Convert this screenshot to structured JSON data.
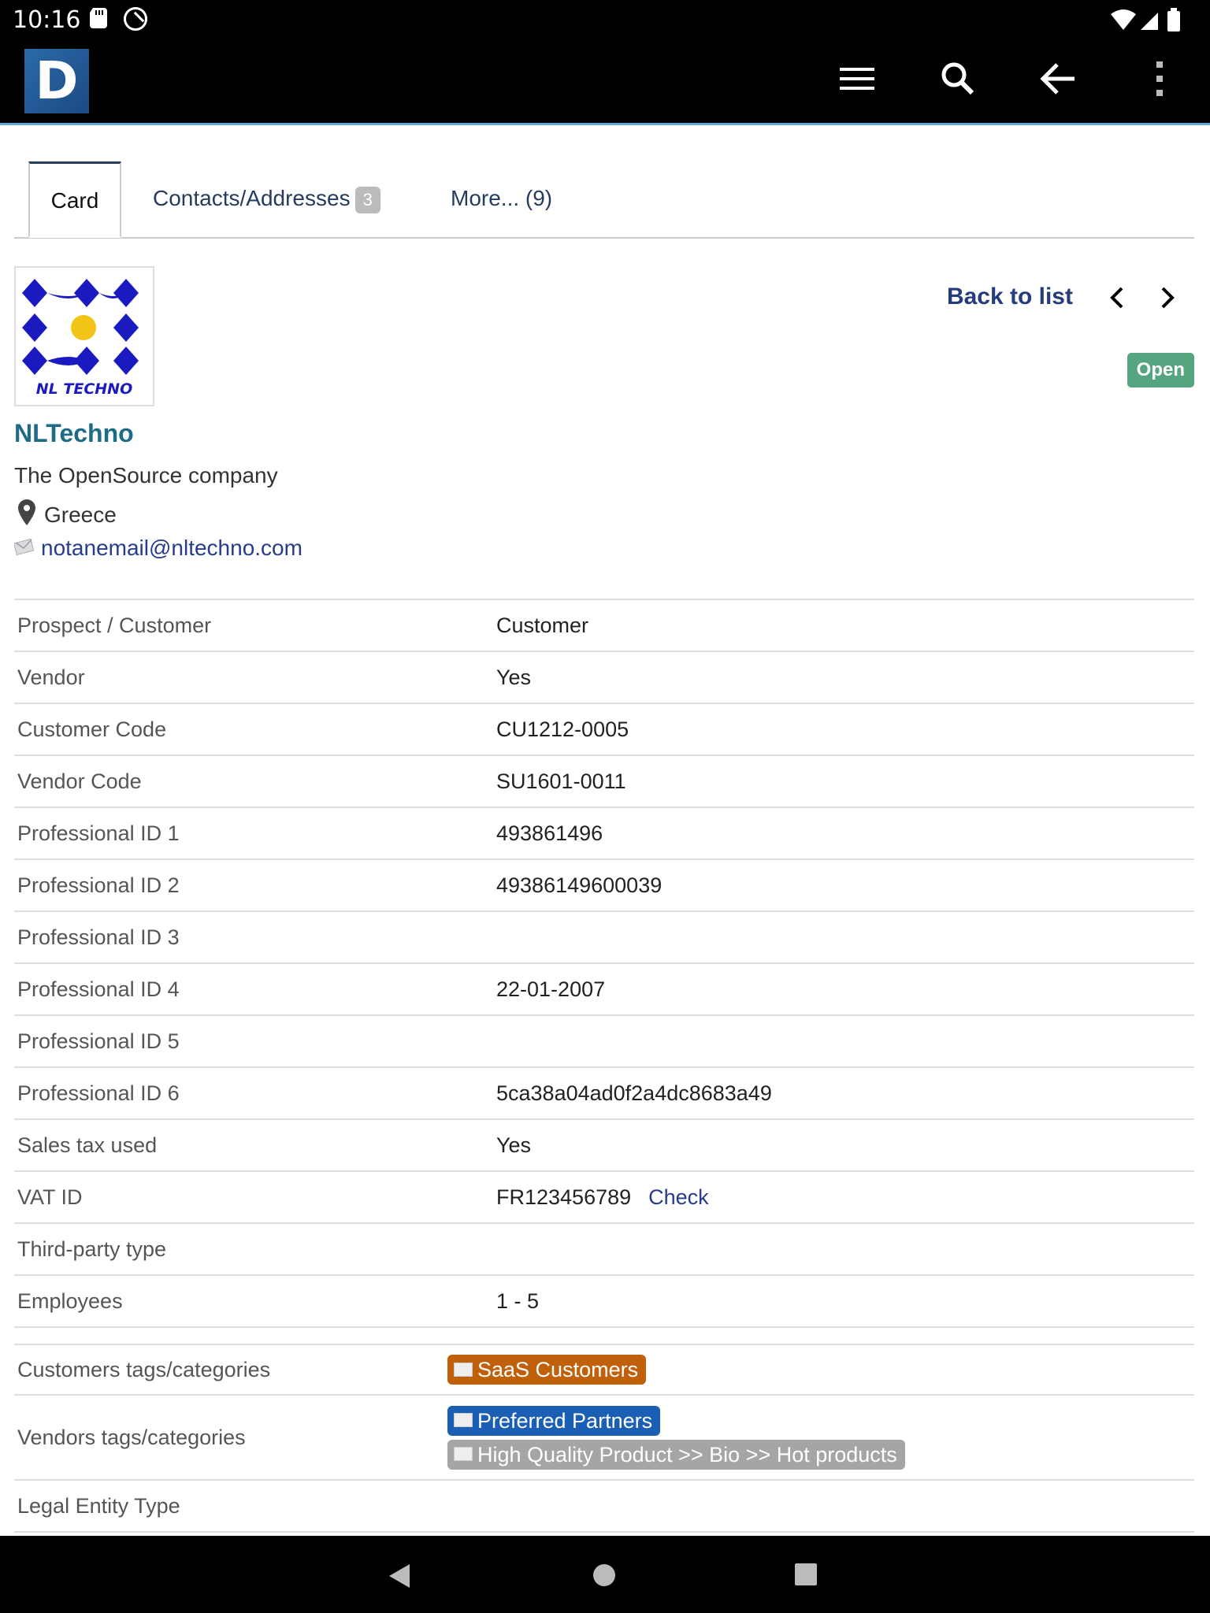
{
  "status_bar": {
    "time": "10:16"
  },
  "tabs": [
    {
      "label": "Card"
    },
    {
      "label": "Contacts/Addresses",
      "badge": "3"
    },
    {
      "label": "More... (9)"
    }
  ],
  "company": {
    "name": "NLTechno",
    "subtitle": "The OpenSource company",
    "country": "Greece",
    "email": "notanemail@nltechno.com",
    "logo_text": "NL TECHNO"
  },
  "nav": {
    "back_to_list": "Back to list"
  },
  "status": "Open",
  "properties": [
    {
      "label": "Prospect / Customer",
      "value": "Customer"
    },
    {
      "label": "Vendor",
      "value": "Yes"
    },
    {
      "label": "Customer Code",
      "value": "CU1212-0005"
    },
    {
      "label": "Vendor Code",
      "value": "SU1601-0011"
    },
    {
      "label": "Professional ID 1",
      "value": "493861496"
    },
    {
      "label": "Professional ID 2",
      "value": "49386149600039"
    },
    {
      "label": "Professional ID 3",
      "value": ""
    },
    {
      "label": "Professional ID 4",
      "value": "22-01-2007"
    },
    {
      "label": "Professional ID 5",
      "value": ""
    },
    {
      "label": "Professional ID 6",
      "value": "5ca38a04ad0f2a4dc8683a49"
    },
    {
      "label": "Sales tax used",
      "value": "Yes"
    },
    {
      "label": "VAT ID",
      "value": "FR123456789",
      "link": "Check"
    },
    {
      "label": "Third-party type",
      "value": ""
    },
    {
      "label": "Employees",
      "value": "1 - 5"
    }
  ],
  "categories": {
    "customers_label": "Customers tags/categories",
    "customers_tags": [
      {
        "label": "SaaS Customers",
        "color": "#c0600a"
      }
    ],
    "vendors_label": "Vendors tags/categories",
    "vendors_tags": [
      {
        "label": "Preferred Partners",
        "color": "#1a5fb4"
      },
      {
        "label": "High Quality Product >> Bio >> Hot products",
        "color": "#a5a5a5"
      }
    ],
    "legal_label": "Legal Entity Type"
  }
}
